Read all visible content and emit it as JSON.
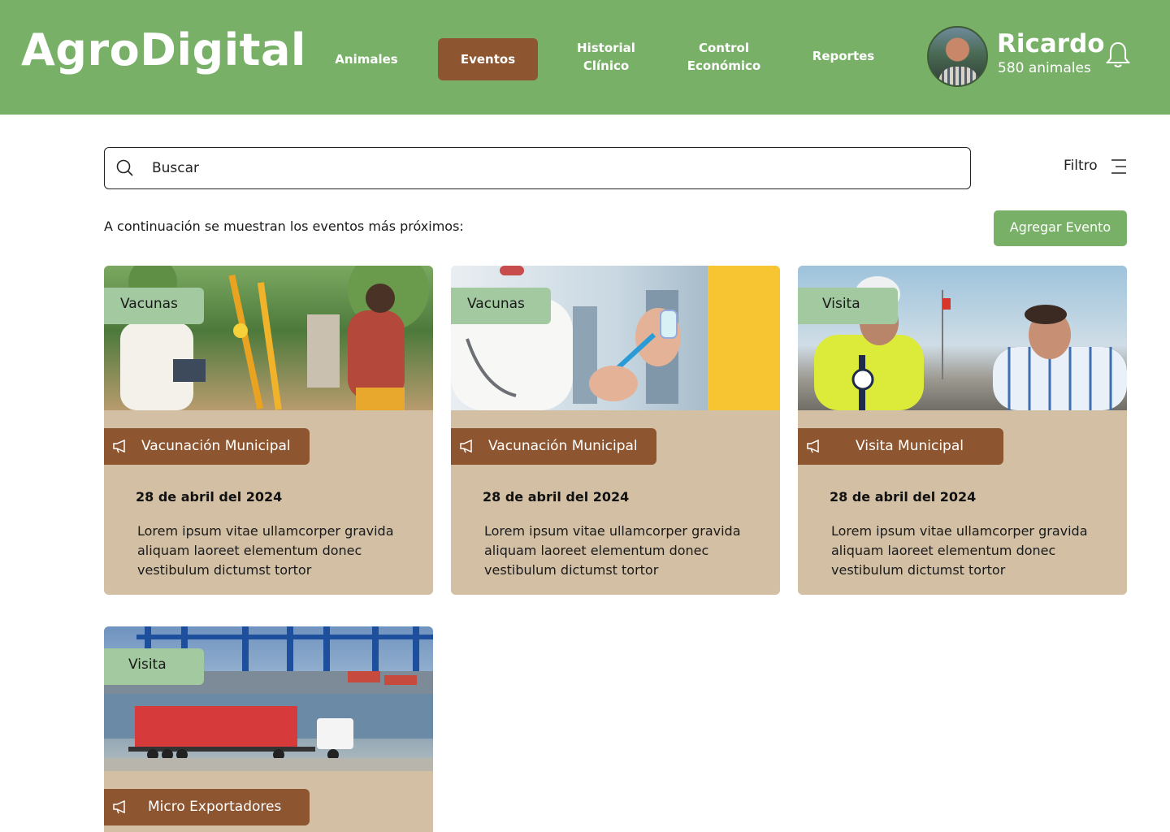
{
  "header": {
    "logo": "AgroDigital",
    "nav": [
      {
        "label": "Animales"
      },
      {
        "label": "Eventos"
      },
      {
        "label": "Historial Clínico"
      },
      {
        "label": "Control Económico"
      },
      {
        "label": "Reportes"
      }
    ],
    "active_nav": "Eventos",
    "user": {
      "name": "Ricardo",
      "subtitle": "580 animales"
    }
  },
  "toolbar": {
    "search_placeholder": "Buscar",
    "filter_label": "Filtro"
  },
  "intro_text": "A continuación se muestran los eventos más próximos:",
  "add_button_label": "Agregar Evento",
  "events": [
    {
      "tag": "Vacunas",
      "title": "Vacunación Municipal",
      "date": "28 de abril del 2024",
      "description": "Lorem ipsum vitae ullamcorper gravida aliquam laoreet elementum donec vestibulum dictumst tortor"
    },
    {
      "tag": "Vacunas",
      "title": "Vacunación Municipal",
      "date": "28 de abril del 2024",
      "description": "Lorem ipsum vitae ullamcorper gravida aliquam laoreet elementum donec vestibulum dictumst tortor"
    },
    {
      "tag": "Visita",
      "title": "Visita Municipal",
      "date": "28 de abril del 2024",
      "description": "Lorem ipsum vitae ullamcorper gravida aliquam laoreet elementum donec vestibulum dictumst tortor"
    },
    {
      "tag": "Visita",
      "title": "Micro Exportadores"
    }
  ],
  "colors": {
    "header_bg": "#79b068",
    "active_nav_bg": "#8e5630",
    "card_bg": "#d2bfa4",
    "tag_bg": "#a3c9a0",
    "event_bar_bg": "#8e5630",
    "add_button_bg": "#79b068"
  }
}
